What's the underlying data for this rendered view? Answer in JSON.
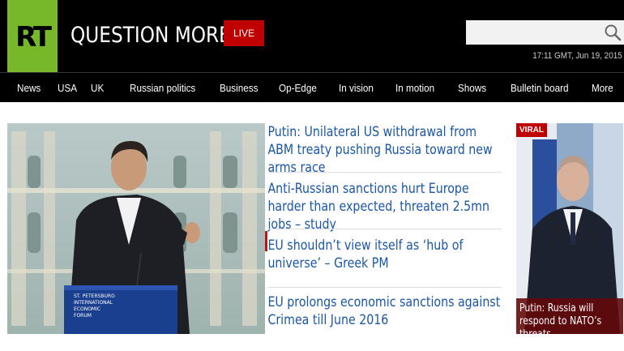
{
  "header": {
    "logo_text": "RT",
    "tagline": "QUESTION MORE.",
    "live_label": "LIVE",
    "search_placeholder": "",
    "datetime": "17:11 GMT, Jun 19, 2015",
    "colors": {
      "logo_green": "#77b82a",
      "live_red": "#c00000"
    }
  },
  "nav": {
    "items": [
      "News",
      "USA",
      "UK",
      "Russian politics",
      "Business",
      "Op-Edge",
      "In vision",
      "In motion",
      "Shows",
      "Bulletin board",
      "More"
    ]
  },
  "main": {
    "photo_icon": "featured-photo-podium",
    "headlines": [
      "Putin: Unilateral US withdrawal from ABM treaty pushing Russia toward new arms race",
      "Anti-Russian sanctions hurt Europe harder than expected, threaten 2.5mn jobs – study",
      "EU shouldn’t view itself as ‘hub of universe’ – Greek PM",
      "EU prolongs economic sanctions against Crimea till June 2016"
    ],
    "headline_color": "#1a57a6"
  },
  "viral": {
    "badge": "VIRAL",
    "caption": "Putin: Russia will respond to NATO’s threats"
  }
}
